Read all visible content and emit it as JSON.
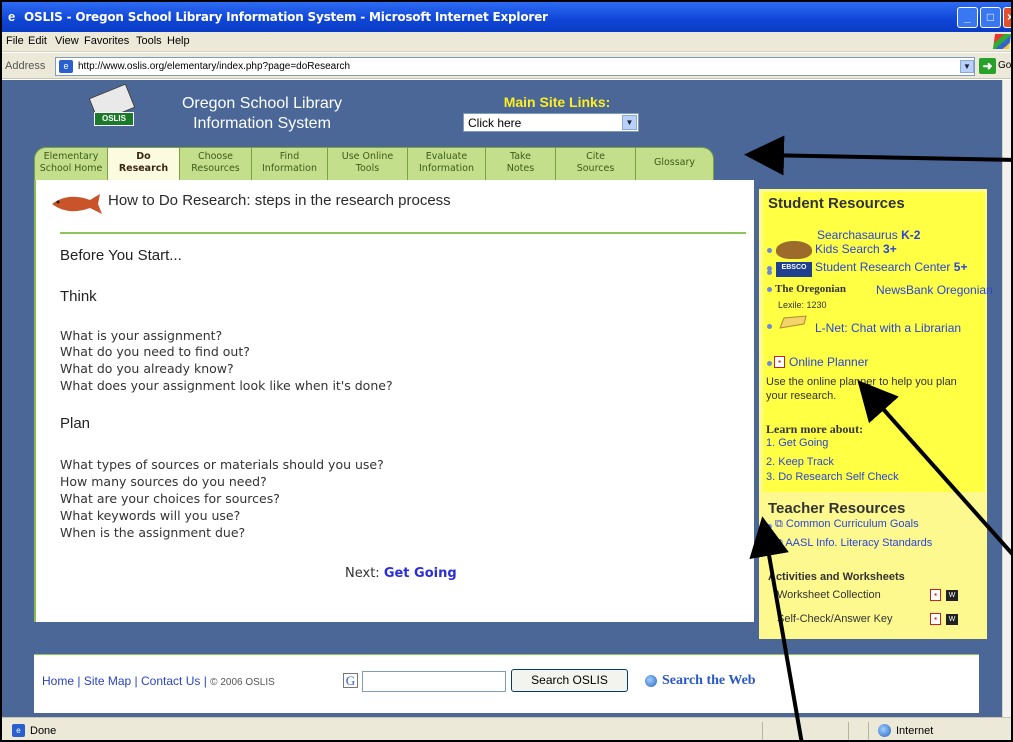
{
  "browser": {
    "title": "OSLIS - Oregon School Library Information System - Microsoft Internet Explorer",
    "menu": [
      "File",
      "Edit",
      "View",
      "Favorites",
      "Tools",
      "Help"
    ],
    "address_label": "Address",
    "url": "http://www.oslis.org/elementary/index.php?page=doResearch",
    "go_label": "Go",
    "status_text": "Done",
    "zone_text": "Internet"
  },
  "header": {
    "logo_text": "OSLIS",
    "site_title_line1": "Oregon School Library",
    "site_title_line2": "Information System",
    "main_links_label": "Main Site Links:",
    "main_links_value": "Click here"
  },
  "tabs": [
    {
      "line1": "Elementary",
      "line2": "School Home"
    },
    {
      "line1": "Do",
      "line2": "Research"
    },
    {
      "line1": "Choose",
      "line2": "Resources"
    },
    {
      "line1": "Find",
      "line2": "Information"
    },
    {
      "line1": "Use Online",
      "line2": "Tools"
    },
    {
      "line1": "Evaluate",
      "line2": "Information"
    },
    {
      "line1": "Take",
      "line2": "Notes"
    },
    {
      "line1": "Cite",
      "line2": "Sources"
    },
    {
      "line1": "Glossary",
      "line2": ""
    }
  ],
  "main": {
    "heading": "How to Do Research: steps in the research process",
    "before_title": "Before You Start...",
    "think_title": "Think",
    "think_questions": [
      "What is your assignment?",
      "What do you need to find out?",
      "What do you already know?",
      "What does your assignment look like when it's done?"
    ],
    "plan_title": "Plan",
    "plan_questions": [
      "What types of sources or materials should you use?",
      "How many sources do you need?",
      "What are your choices for sources?",
      "What keywords will you use?",
      "When is the assignment due?"
    ],
    "next_label": "Next:",
    "next_link": "Get Going"
  },
  "student_resources": {
    "title": "Student Resources",
    "searchasaurus": "Searchasaurus",
    "searchasaurus_grade": "K-2",
    "kids_search": "Kids Search",
    "kids_search_grade": "3+",
    "src": "Student Research Center",
    "src_grade": "5+",
    "oregonian_logo": "The Oregonian",
    "newsbank": "NewsBank Oregonian",
    "lexile": "Lexile: 1230",
    "lnet": "L-Net: Chat with a Librarian",
    "online_planner": "Online Planner",
    "planner_desc": "Use the online planner to help you plan your research.",
    "learn_more": "Learn more about:",
    "learn_items": [
      "1. Get Going",
      "2. Keep Track",
      "3. Do Research Self Check"
    ]
  },
  "teacher_resources": {
    "title": "Teacher Resources",
    "ccg": "Common Curriculum Goals",
    "aasl": "AASL Info. Literacy Standards",
    "activities_title": "Activities and Worksheets",
    "worksheet": "Worksheet Collection",
    "selfcheck": "Self-Check/Answer Key"
  },
  "footer": {
    "home": "Home",
    "sitemap": "Site Map",
    "contact": "Contact Us",
    "sep": "|",
    "copyright": "© 2006 OSLIS",
    "search_button": "Search OSLIS",
    "search_web": "Search the Web"
  },
  "icons": {
    "ie": "ie-icon",
    "go": "go-arrow-icon",
    "pdf": "pdf-icon",
    "word": "word-icon"
  },
  "colors": {
    "viewport_bg": "#4a6798",
    "tab_green": "#c4df8c",
    "active_tab": "#fbfbe0",
    "student_yellow": "#ffff44",
    "link_blue": "#2a44d8",
    "main_links_yellow": "#ffee22"
  }
}
